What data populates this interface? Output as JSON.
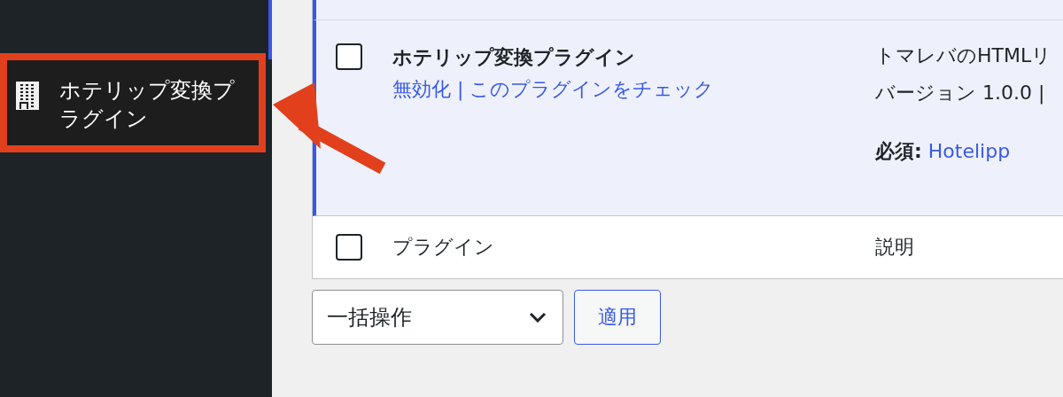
{
  "sidebar": {
    "items": [
      {
        "label": "ホテリップ変換プラグイン",
        "current": true
      }
    ]
  },
  "annotations": {
    "highlight_frame": true,
    "arrow": true
  },
  "plugins_table": {
    "rows": [
      {
        "active": true,
        "checked": false,
        "name": "ホテリップ変換プラグイン",
        "actions": [
          {
            "label": "無効化"
          },
          {
            "label": "このプラグインをチェック"
          }
        ],
        "action_separator": "|",
        "description": "トマレバのHTMLリ",
        "meta": "バージョン 1.0.0 |",
        "requires_label": "必須:",
        "requires_link": "Hotelipp"
      }
    ],
    "footer": {
      "checked": false,
      "column_1": "プラグイン",
      "column_2": "説明"
    }
  },
  "bulk_actions": {
    "select": "一括操作",
    "apply_button": "適用"
  }
}
